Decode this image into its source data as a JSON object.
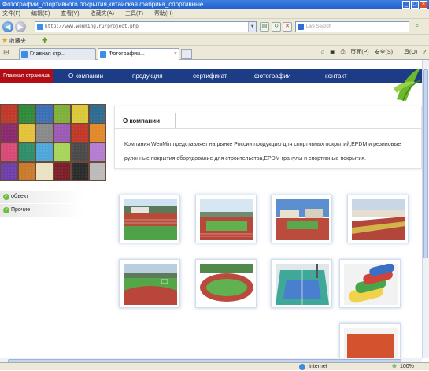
{
  "window": {
    "title": "Фотографии_спортивного покрытия,китайская фабрика_спортивные..."
  },
  "menu": [
    "文件(F)",
    "编辑(E)",
    "查看(V)",
    "收藏夹(A)",
    "工具(T)",
    "帮助(H)"
  ],
  "address": {
    "url": "http://www.wenming.ru/project.php"
  },
  "search": {
    "placeholder": "Live Search"
  },
  "favorites": {
    "label": "收藏夹"
  },
  "tabs": [
    {
      "label": "Главная стр..."
    },
    {
      "label": "Фотографии..."
    }
  ],
  "tools": {
    "page": "页面(P)",
    "safety": "安全(S)",
    "tools": "工具(O)"
  },
  "status": {
    "zone": "Internet",
    "zoom": "100%"
  },
  "site": {
    "nav": {
      "home": "Главная страница",
      "items": [
        "О компании",
        "продукция",
        "сертификат",
        "фотографии",
        "контакт"
      ]
    },
    "about_title": "О компании",
    "about_text": "Компания WenMin представляет на рынке России продукцию для спортивных покрытий,EPDM и резиновые рулонные покрытия,оборудование для строительства,EPDM гранулы и спортивные покрытия.",
    "side_items": [
      "объект",
      "Прочие"
    ]
  },
  "colors": {
    "nav_bg": "#1c3c85",
    "home_bg": "#b00e14"
  }
}
